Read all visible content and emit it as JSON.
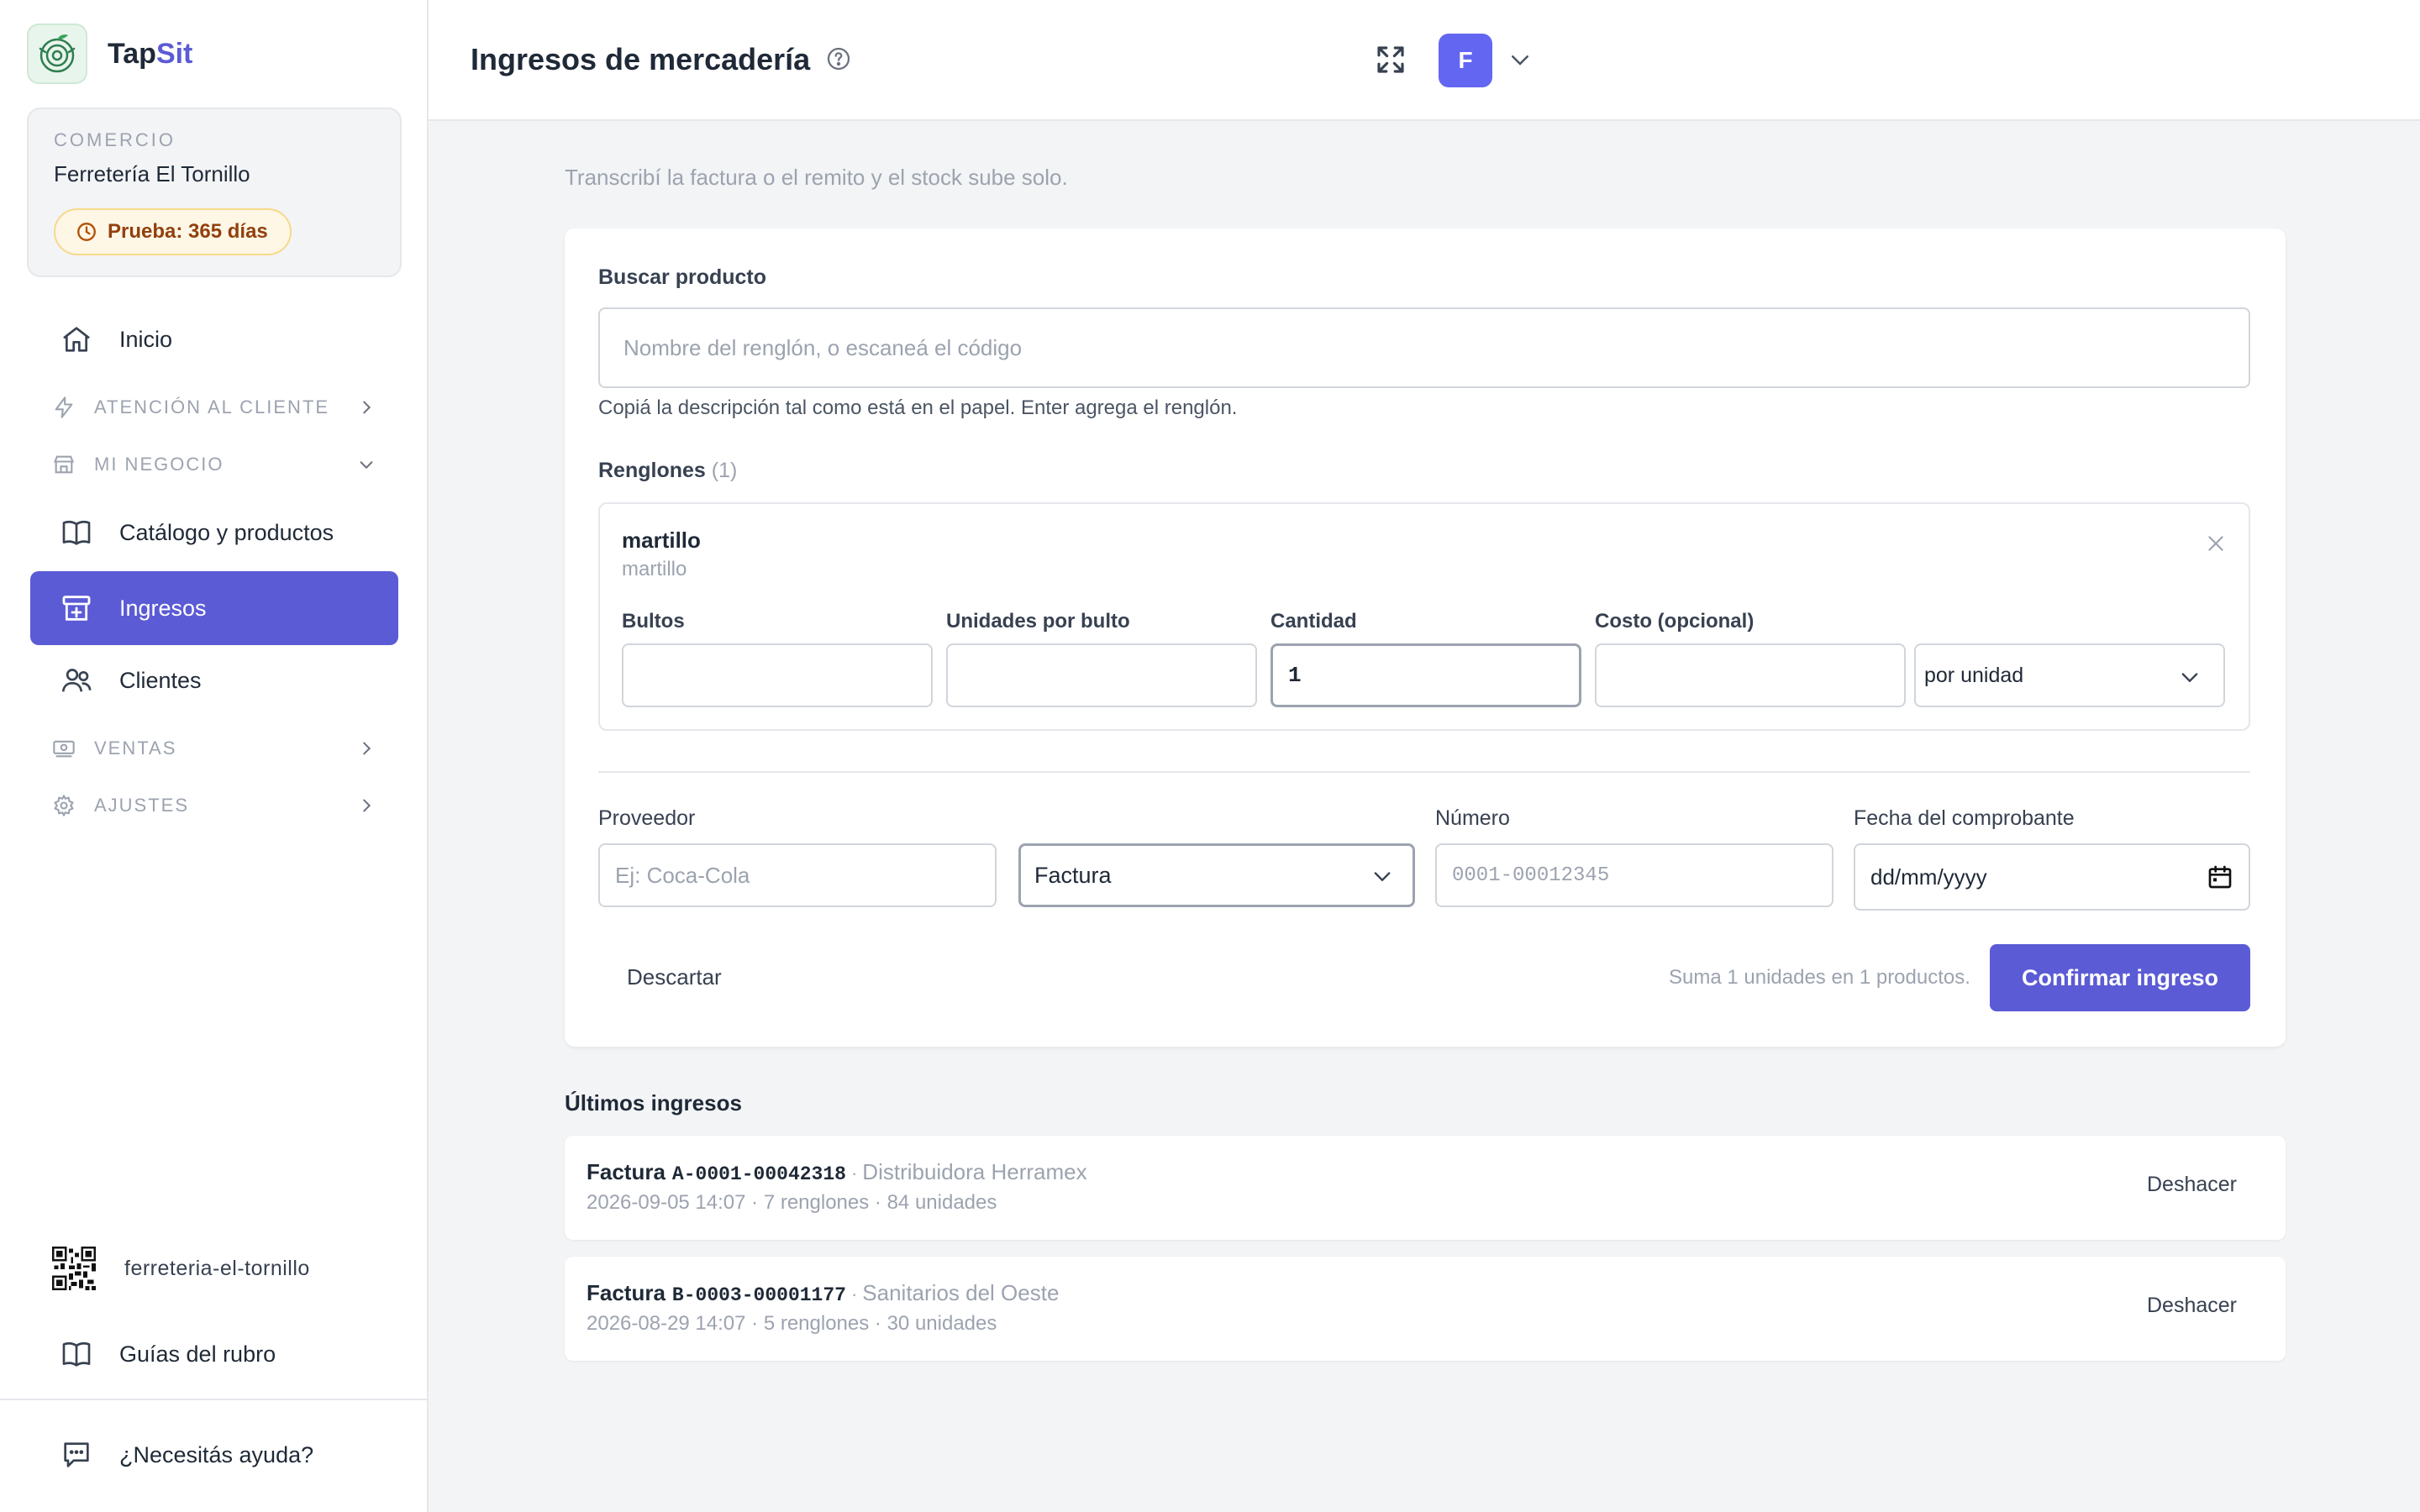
{
  "brand": {
    "name_part1": "Tap",
    "name_part2": "Sit",
    "accent_color": "#5b5bd6"
  },
  "store": {
    "eyebrow": "COMERCIO",
    "name": "Ferretería El Tornillo",
    "trial_badge": "Prueba: 365 días"
  },
  "sidebar": {
    "inicio": "Inicio",
    "atencion": "ATENCIÓN AL CLIENTE",
    "mi_negocio": "MI NEGOCIO",
    "catalogo": "Catálogo y productos",
    "ingresos": "Ingresos",
    "clientes": "Clientes",
    "ventas": "VENTAS",
    "ajustes": "AJUSTES",
    "slug": "ferreteria-el-tornillo",
    "guias": "Guías del rubro",
    "ayuda": "¿Necesitás ayuda?"
  },
  "header": {
    "title": "Ingresos de mercadería",
    "avatar_initial": "F"
  },
  "main": {
    "subtitle": "Transcribí la factura o el remito y el stock sube solo.",
    "search_label": "Buscar producto",
    "search_placeholder": "Nombre del renglón, o escaneá el código",
    "search_hint": "Copiá la descripción tal como está en el papel. Enter agrega el renglón.",
    "lines_label": "Renglones",
    "lines_count": "(1)",
    "line": {
      "name": "martillo",
      "subtitle": "martillo",
      "bultos_label": "Bultos",
      "bultos_value": "",
      "unidades_label": "Unidades por bulto",
      "unidades_value": "",
      "cantidad_label": "Cantidad",
      "cantidad_value": "1",
      "costo_label": "Costo (opcional)",
      "costo_value": "",
      "unit_selected": "por unidad"
    },
    "proveedor_label": "Proveedor",
    "proveedor_placeholder": "Ej: Coca-Cola",
    "tipo_selected": "Factura",
    "numero_label": "Número",
    "numero_placeholder": "0001-00012345",
    "fecha_label": "Fecha del comprobante",
    "fecha_placeholder": "dd/mm/yyyy",
    "discard": "Descartar",
    "summary": "Suma 1 unidades en 1 productos.",
    "confirm": "Confirmar ingreso"
  },
  "recent": {
    "title": "Últimos ingresos",
    "sep": "·",
    "items": [
      {
        "doc_type": "Factura",
        "code": "A-0001-00042318",
        "supplier": "Distribuidora Herramex",
        "meta": "2026-09-05 14:07 · 7 renglones · 84 unidades",
        "undo": "Deshacer"
      },
      {
        "doc_type": "Factura",
        "code": "B-0003-00001177",
        "supplier": "Sanitarios del Oeste",
        "meta": "2026-08-29 14:07 · 5 renglones · 30 unidades",
        "undo": "Deshacer"
      }
    ]
  }
}
